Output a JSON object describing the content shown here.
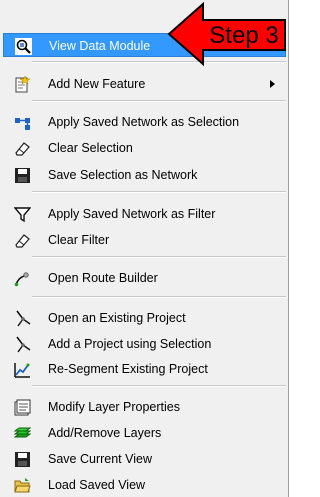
{
  "menu": {
    "items": [
      {
        "label": "View Data Module",
        "icon": "magnifier-data-icon"
      },
      {
        "label": "Add New Feature",
        "icon": "new-feature-icon"
      },
      {
        "label": "Apply Saved Network as Selection",
        "icon": "network-selection-icon"
      },
      {
        "label": "Clear Selection",
        "icon": "eraser-icon"
      },
      {
        "label": "Save Selection as Network",
        "icon": "floppy-disk-icon"
      },
      {
        "label": "Apply Saved Network as Filter",
        "icon": "filter-funnel-icon"
      },
      {
        "label": "Clear Filter",
        "icon": "eraser-icon"
      },
      {
        "label": "Open Route Builder",
        "icon": "route-builder-icon"
      },
      {
        "label": "Open an Existing Project",
        "icon": "project-compass-icon"
      },
      {
        "label": "Add a Project using Selection",
        "icon": "project-compass-icon"
      },
      {
        "label": "Re-Segment Existing Project",
        "icon": "resegment-chart-icon"
      },
      {
        "label": "Modify Layer Properties",
        "icon": "layer-properties-icon"
      },
      {
        "label": "Add/Remove Layers",
        "icon": "layers-stack-icon"
      },
      {
        "label": "Save Current View",
        "icon": "floppy-disk-icon"
      },
      {
        "label": "Load Saved View",
        "icon": "open-folder-icon"
      }
    ],
    "highlighted": "View Data Module",
    "submenu_item": "Add New Feature"
  },
  "callout": {
    "text": "Step 3",
    "color": "#ff0000"
  },
  "colors": {
    "highlight": "#3399ff",
    "menu_bg": "#f0f0f0"
  }
}
